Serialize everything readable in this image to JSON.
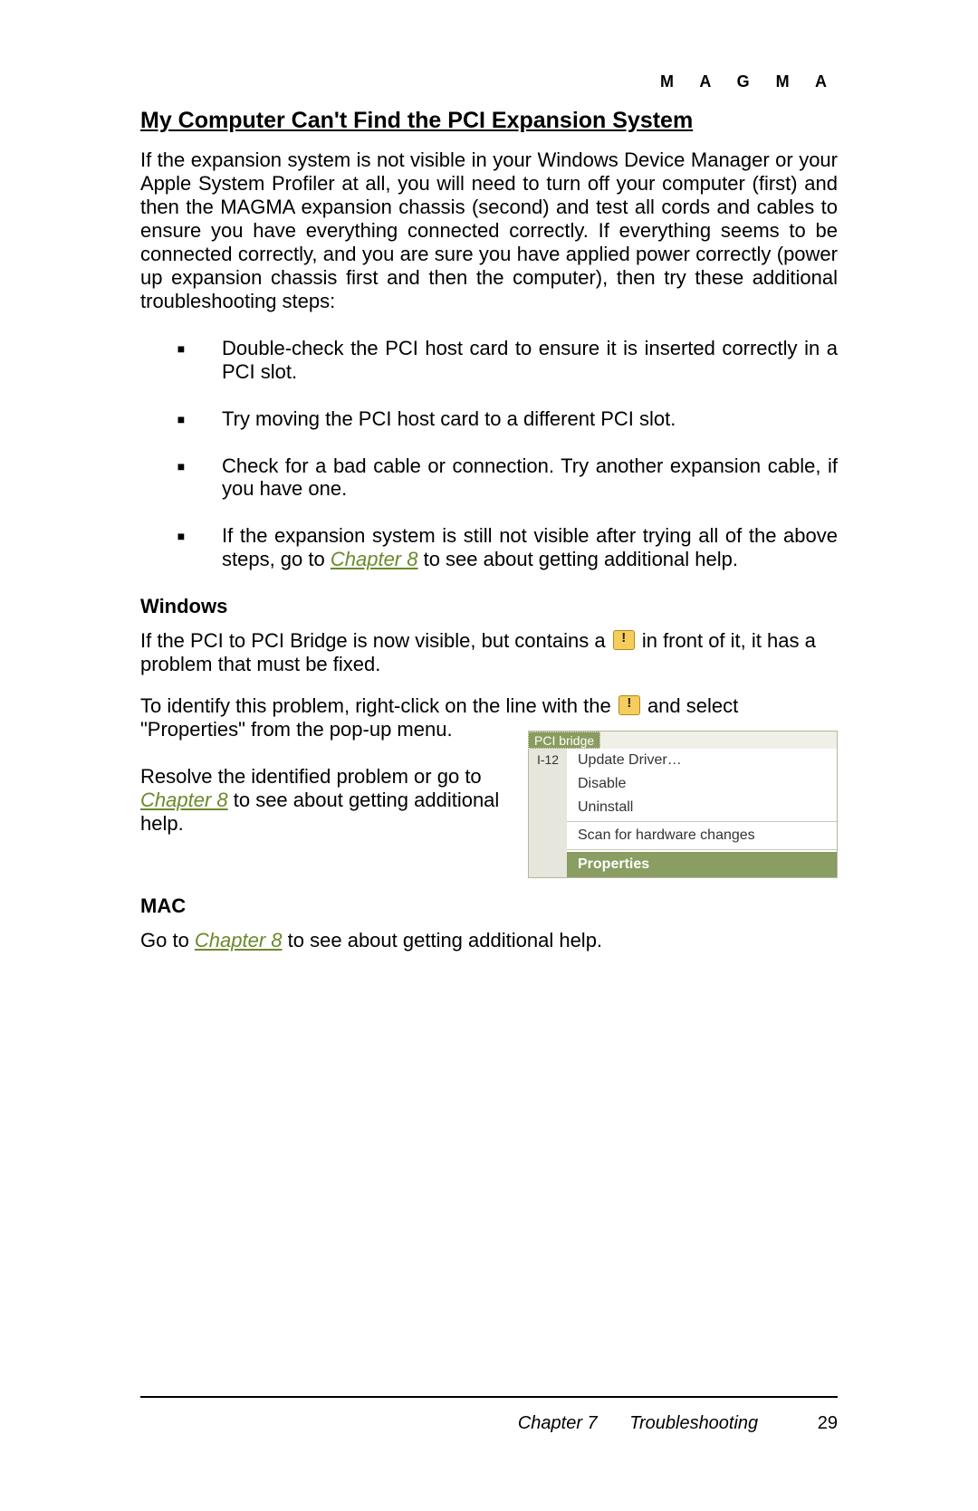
{
  "brand": "M A G M A",
  "title": "My Computer Can't Find the PCI Expansion System",
  "intro": "If the expansion system is not visible in your Windows Device Manager or your Apple System Profiler at all, you will need to turn off your computer (first) and then the MAGMA expansion chassis (second) and test all cords and cables to ensure you have everything connected correctly. If everything seems to be connected correctly, and you are sure you have applied power correctly (power up expansion chassis first and then the computer), then try these additional troubleshooting steps:",
  "bullets": {
    "b1": "Double-check the PCI host card to ensure it is inserted correctly in a PCI slot.",
    "b2": "Try moving the PCI host card to a different PCI slot.",
    "b3": "Check for a bad cable or connection. Try another expansion cable, if you have one.",
    "b4_pre": "If the expansion system is still not visible after trying all of the above steps, go to ",
    "b4_link": "Chapter 8",
    "b4_post": " to see about getting additional help."
  },
  "windows": {
    "heading": "Windows",
    "p1_pre": "If the PCI to PCI Bridge is now visible, but contains a ",
    "p1_post": " in front of it, it has a problem that must be fixed.",
    "p2_pre": "To identify this problem, right-click on the line with the ",
    "p2_post": " and select \"Properties\" from the pop-up menu.",
    "p3_pre": "Resolve the identified problem or go to ",
    "p3_link": "Chapter 8",
    "p3_post": " to see about getting additional help."
  },
  "mac": {
    "heading": "MAC",
    "p_pre": "Go to ",
    "p_link": "Chapter 8",
    "p_post": " to see about getting additional help."
  },
  "context_menu": {
    "selected_node": "PCI bridge",
    "left_label": "I-12",
    "items": {
      "update": "Update Driver…",
      "disable": "Disable",
      "uninstall": "Uninstall",
      "scan": "Scan for hardware changes",
      "properties": "Properties"
    }
  },
  "footer": {
    "chapter": "Chapter 7",
    "section": "Troubleshooting",
    "page": "29"
  }
}
